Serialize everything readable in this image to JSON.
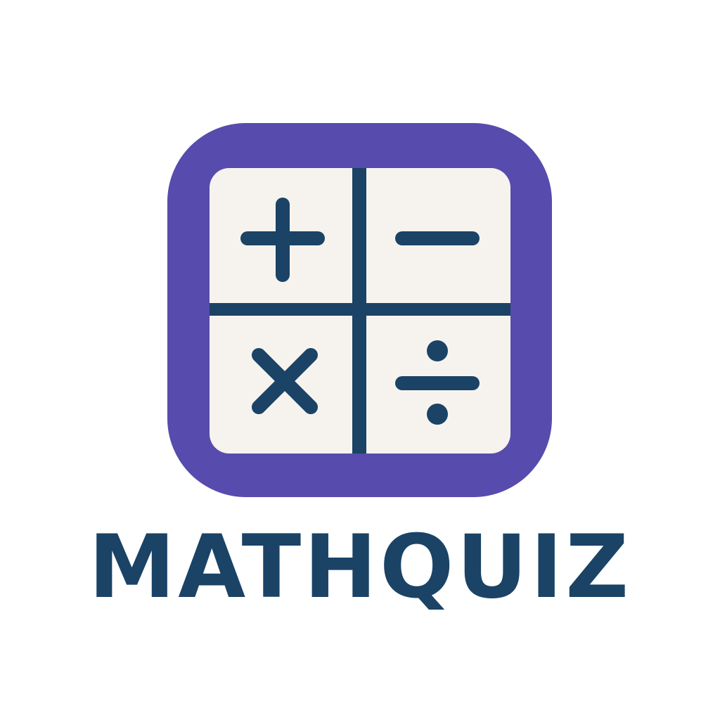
{
  "logo": {
    "app_name": "MATHQUIZ",
    "frame_color": "#574bad",
    "face_color": "#f6f3ef",
    "ink_color": "#1a4366",
    "symbols": [
      "plus-icon",
      "minus-icon",
      "multiply-icon",
      "divide-icon"
    ]
  }
}
